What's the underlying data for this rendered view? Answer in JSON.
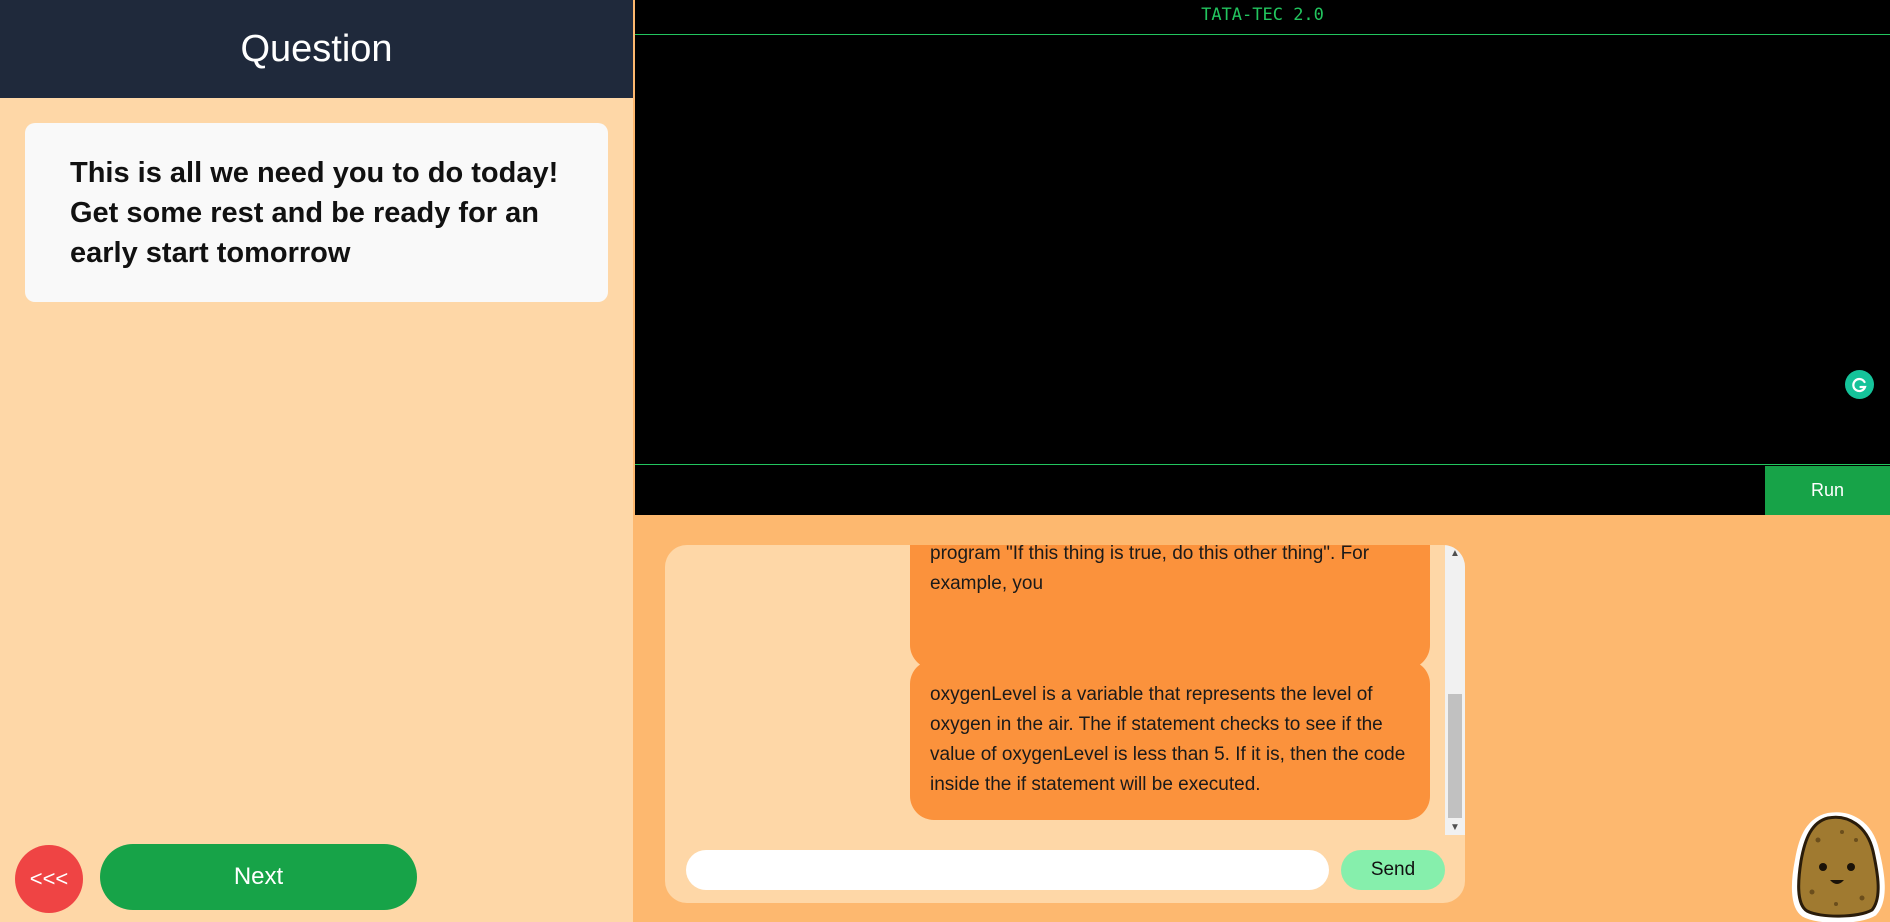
{
  "question_panel": {
    "title": "Question",
    "text": "This is all we need you to do today! Get some rest and be ready for an early start tomorrow",
    "back_label": "<<<",
    "next_label": "Next"
  },
  "terminal": {
    "title": "TATA-TEC 2.0",
    "input_value": "",
    "run_label": "Run",
    "accent_color": "#22c55e"
  },
  "chat": {
    "messages": [
      {
        "text": "program \"If this thing is true, do this other thing\". For example, you"
      },
      {
        "text": "oxygenLevel is a variable that represents the level of oxygen in the air. The if statement checks to see if the value of oxygenLevel is less than 5. If it is, then the code inside the if statement will be executed."
      }
    ],
    "input_value": "",
    "send_label": "Send"
  },
  "icons": {
    "grammarly": "grammarly-icon",
    "mascot": "potato-mascot-icon",
    "scroll_up": "scroll-up-arrow-icon",
    "scroll_down": "scroll-down-arrow-icon"
  },
  "colors": {
    "header_bg": "#1f293b",
    "left_bg": "#fed7a7",
    "right_bg": "#fdb86f",
    "green": "#17a348",
    "red": "#ef4444",
    "bubble": "#fb923c",
    "send": "#86efac"
  }
}
